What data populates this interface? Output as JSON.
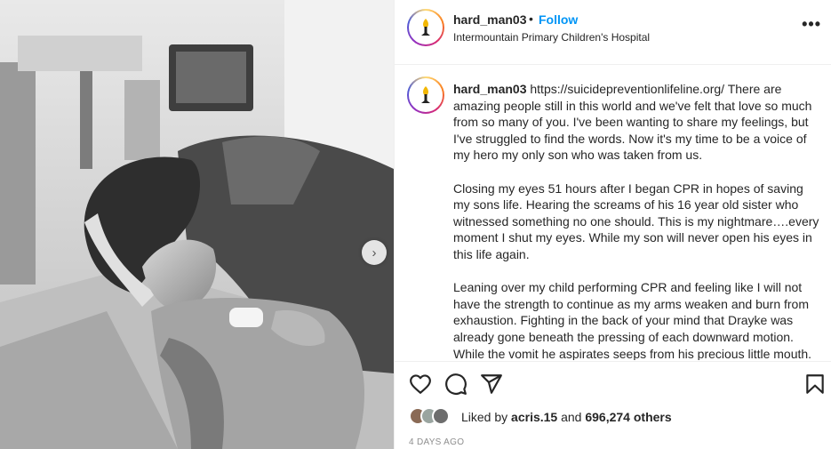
{
  "post": {
    "username": "hard_man03",
    "separator": "•",
    "follow_label": "Follow",
    "location": "Intermountain Primary Children's Hospital",
    "more_label": "•••",
    "carousel_next": "›"
  },
  "caption": {
    "username": "hard_man03",
    "paragraphs": [
      "https://suicidepreventionlifeline.org/ There are amazing people still in this world and we've felt that love so much from so many of you. I've been wanting to share my feelings, but I've struggled to find the words. Now it's my time to be a voice of my hero my only son who was taken from us.",
      "Closing my eyes 51 hours after I began CPR in hopes of saving my sons life. Hearing the screams of his 16 year old sister who witnessed something no one should. This is my nightmare….every moment I shut my eyes. While my son will never open his eyes in this life again.",
      "Leaning over my child performing CPR and feeling like I will not have the strength to continue as my arms weaken and burn from exhaustion. Fighting in the back of your mind that Drayke was already gone beneath the pressing of each downward motion. While the vomit he aspirates seeps from his precious little mouth."
    ]
  },
  "actions": {
    "like_icon": "heart-icon",
    "comment_icon": "comment-icon",
    "share_icon": "share-icon",
    "save_icon": "bookmark-icon"
  },
  "likes": {
    "prefix": "Liked by",
    "user": "acris.15",
    "joiner": "and",
    "count": "696,274 others"
  },
  "timestamp": "4 DAYS AGO",
  "colors": {
    "accent": "#0095f6",
    "text": "#262626",
    "muted": "#8e8e8e",
    "divider": "#efefef"
  }
}
